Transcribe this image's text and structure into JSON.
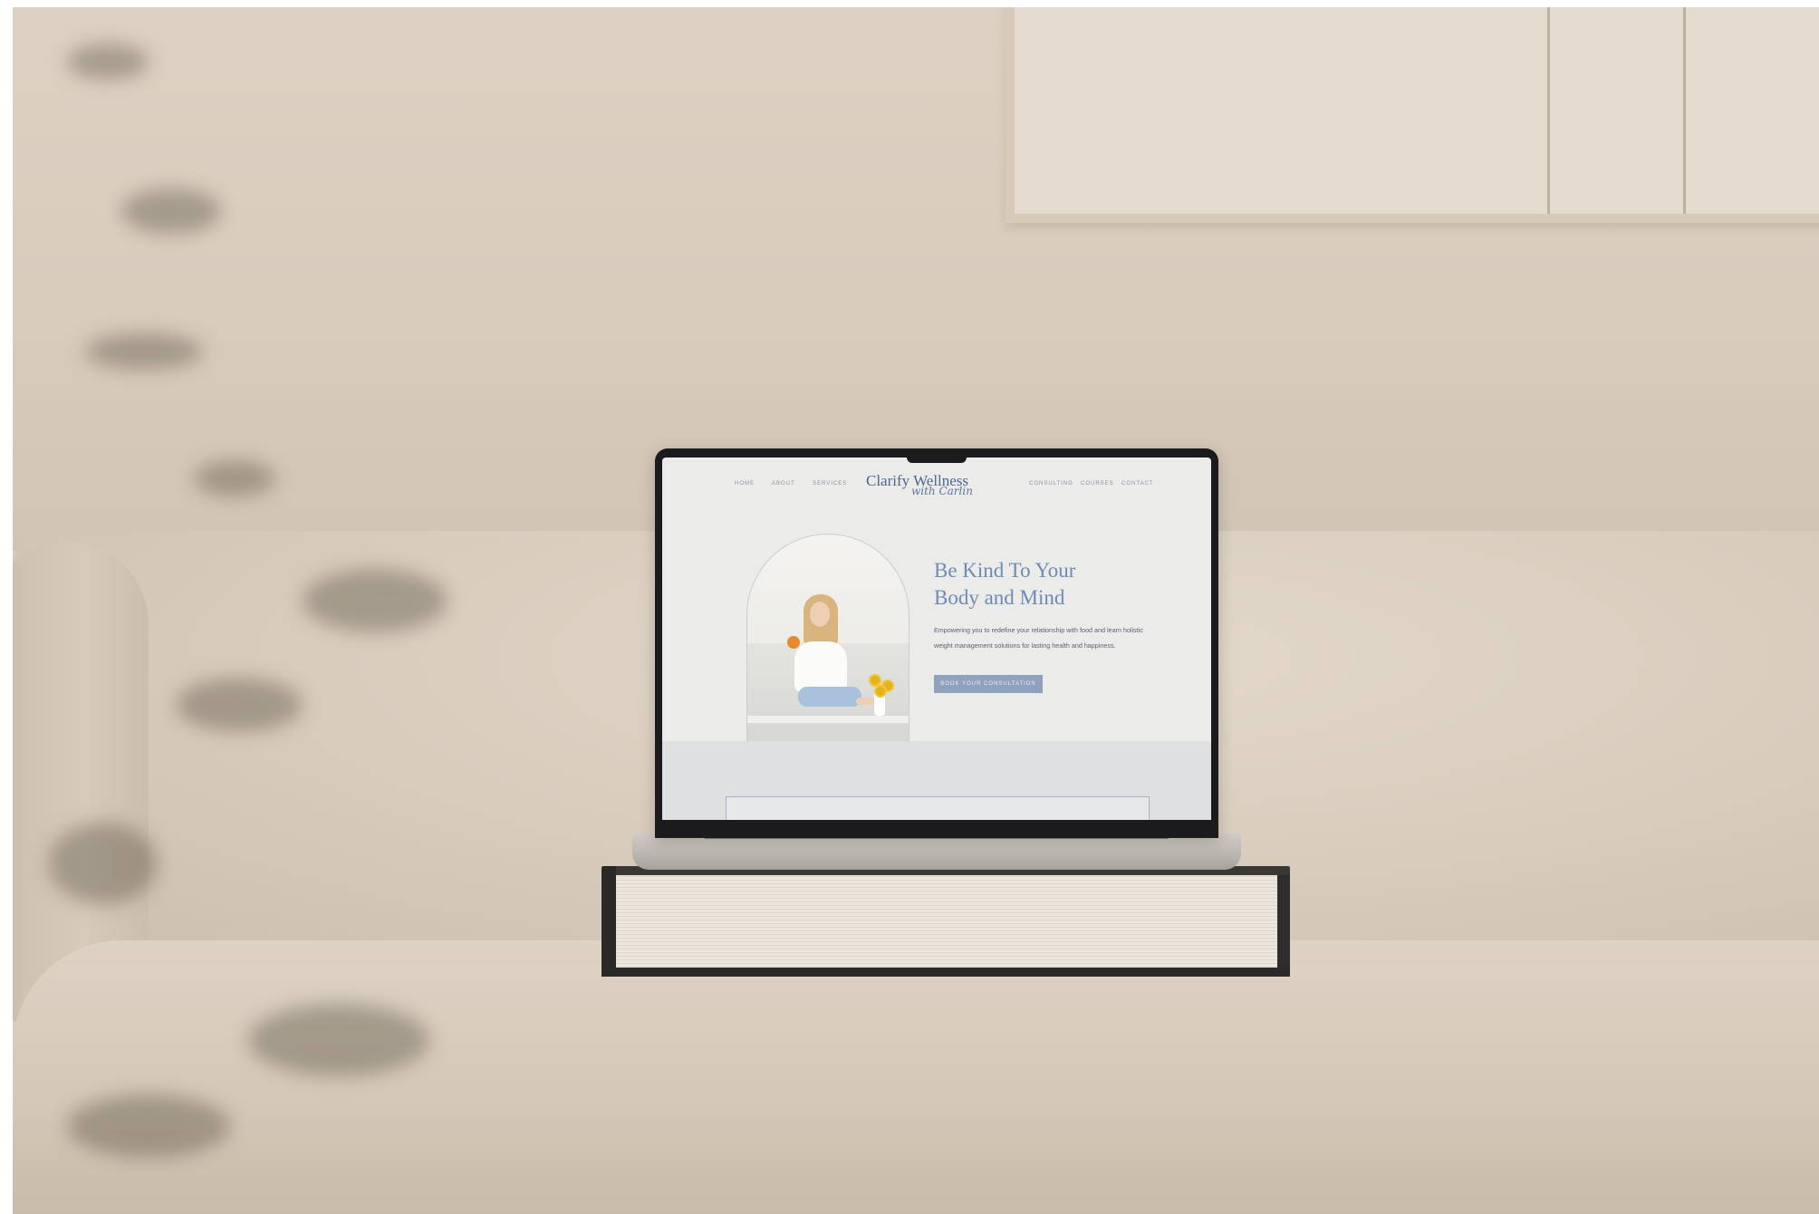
{
  "site": {
    "brand": {
      "name": "Clarify Wellness",
      "script": "with Carlin"
    },
    "nav": {
      "left": [
        "HOME",
        "ABOUT",
        "SERVICES"
      ],
      "right": [
        "CONSULTING",
        "COURSES",
        "CONTACT"
      ]
    },
    "hero": {
      "title_line1": "Be Kind To Your",
      "title_line2": "Body and Mind",
      "body": "Empowering you to redefine your relationship with food and learn holistic weight management solutions for lasting health and happiness.",
      "cta_label": "BOOK YOUR CONSULTATION"
    }
  },
  "colors": {
    "brand_blue": "#4c6690",
    "title_blue": "#6e8bb3",
    "cta_blue": "#8fa1bd",
    "screen_bg": "#ebebe9"
  }
}
